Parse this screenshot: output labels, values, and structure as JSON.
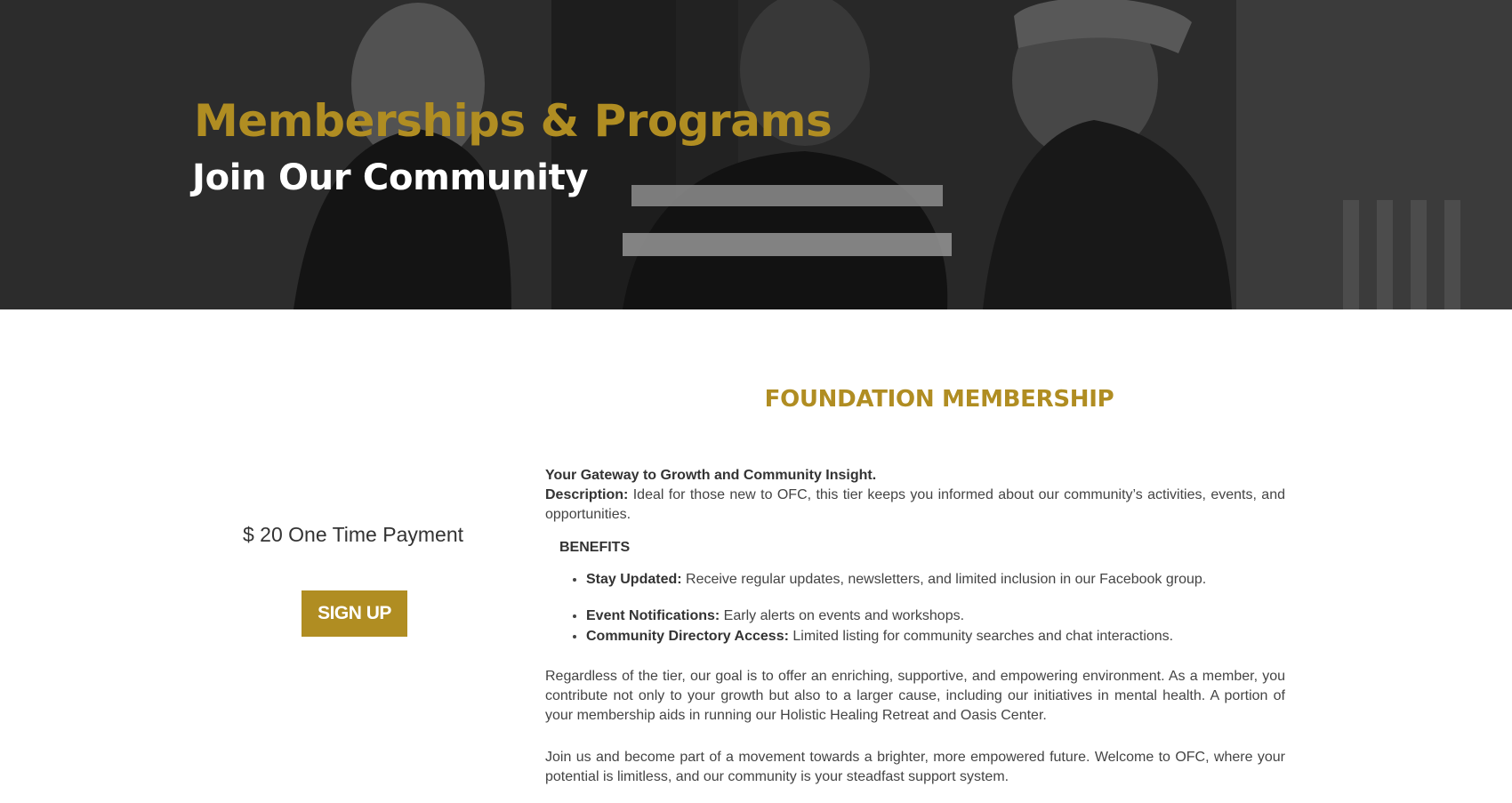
{
  "hero": {
    "title": "Memberships & Programs",
    "subtitle": "Join Our Community"
  },
  "membership": {
    "title": "FOUNDATION MEMBERSHIP",
    "price": "$ 20 One Time Payment",
    "signup_label": "SIGN UP",
    "tagline": "Your Gateway to Growth and Community Insight.",
    "description_label": "Description:",
    "description_text": " Ideal for those new to OFC, this tier keeps you informed about our community’s activities, events, and opportunities.",
    "benefits_heading": "BENEFITS",
    "benefits": [
      {
        "label": "Stay Updated:",
        "text": " Receive regular updates, newsletters, and limited inclusion in our Facebook group."
      },
      {
        "label": "Event Notifications:",
        "text": " Early alerts on events and workshops."
      },
      {
        "label": "Community Directory Access:",
        "text": " Limited listing for community searches and chat interactions."
      }
    ],
    "paragraphs": [
      "Regardless of the tier, our goal is to offer an enriching, supportive, and empowering environment. As a member, you contribute not only to your growth but also to a larger cause, including our initiatives in mental health. A portion of your membership aids in running our Holistic Healing Retreat and Oasis Center.",
      "Join us and become part of a movement towards a brighter, more empowered future. Welcome to OFC, where your potential is limitless, and our community is your steadfast support system."
    ]
  },
  "colors": {
    "accent": "#b08d22",
    "hero_text": "#ffffff",
    "body_text": "#444444"
  }
}
